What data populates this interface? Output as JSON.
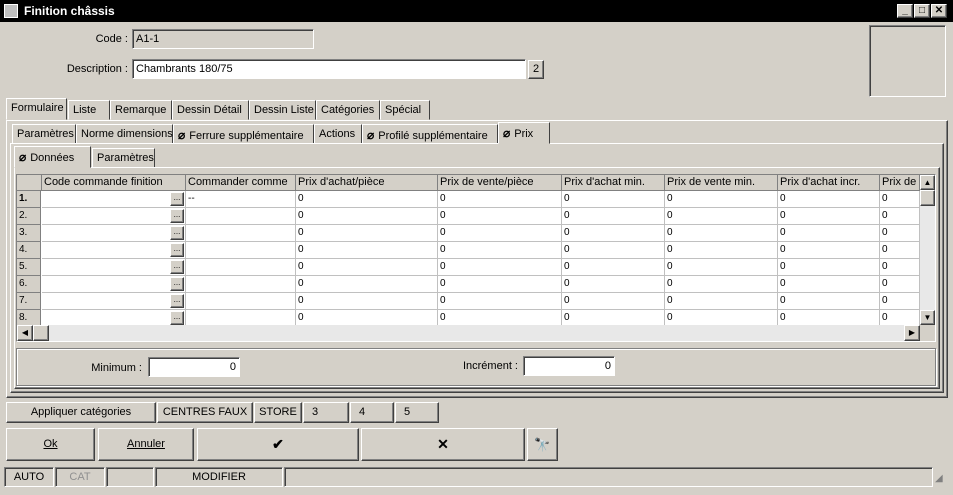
{
  "window": {
    "title": "Finition châssis",
    "minimize": "_",
    "maximize": "□",
    "close": "✕"
  },
  "header": {
    "code_label": "Code :",
    "code_value": "A1-1",
    "description_label": "Description :",
    "description_value": "Chambrants 180/75",
    "description_badge": "2"
  },
  "tabs_main": [
    "Formulaire",
    "Liste",
    "Remarque",
    "Dessin Détail",
    "Dessin Liste",
    "Catégories",
    "Spécial"
  ],
  "tabs_sub": [
    {
      "label": "Paramètres",
      "icon": ""
    },
    {
      "label": "Norme dimensions",
      "icon": ""
    },
    {
      "label": "Ferrure supplémentaire",
      "icon": "paperclip-icon"
    },
    {
      "label": "Actions",
      "icon": ""
    },
    {
      "label": "Profilé supplémentaire",
      "icon": "paperclip-icon"
    },
    {
      "label": "Prix",
      "icon": "paperclip-icon"
    }
  ],
  "tabs_inner": [
    {
      "label": "Données",
      "icon": "paperclip-icon"
    },
    {
      "label": "Paramètres",
      "icon": ""
    }
  ],
  "grid": {
    "columns": [
      "Code commande finition",
      "Commander comme",
      "Prix d'achat/pièce",
      "Prix de vente/pièce",
      "Prix d'achat min.",
      "Prix de vente min.",
      "Prix d'achat incr.",
      "Prix de vente incr."
    ],
    "rows": [
      {
        "num": "1.",
        "c0": "",
        "c1": "--",
        "c2": "0",
        "c3": "0",
        "c4": "0",
        "c5": "0",
        "c6": "0",
        "c7": "0"
      },
      {
        "num": "2.",
        "c0": "",
        "c1": "",
        "c2": "0",
        "c3": "0",
        "c4": "0",
        "c5": "0",
        "c6": "0",
        "c7": "0"
      },
      {
        "num": "3.",
        "c0": "",
        "c1": "",
        "c2": "0",
        "c3": "0",
        "c4": "0",
        "c5": "0",
        "c6": "0",
        "c7": "0"
      },
      {
        "num": "4.",
        "c0": "",
        "c1": "",
        "c2": "0",
        "c3": "0",
        "c4": "0",
        "c5": "0",
        "c6": "0",
        "c7": "0"
      },
      {
        "num": "5.",
        "c0": "",
        "c1": "",
        "c2": "0",
        "c3": "0",
        "c4": "0",
        "c5": "0",
        "c6": "0",
        "c7": "0"
      },
      {
        "num": "6.",
        "c0": "",
        "c1": "",
        "c2": "0",
        "c3": "0",
        "c4": "0",
        "c5": "0",
        "c6": "0",
        "c7": "0"
      },
      {
        "num": "7.",
        "c0": "",
        "c1": "",
        "c2": "0",
        "c3": "0",
        "c4": "0",
        "c5": "0",
        "c6": "0",
        "c7": "0"
      },
      {
        "num": "8.",
        "c0": "",
        "c1": "",
        "c2": "0",
        "c3": "0",
        "c4": "0",
        "c5": "0",
        "c6": "0",
        "c7": "0"
      }
    ],
    "ellipsis": "..."
  },
  "minmax": {
    "min_label": "Minimum :",
    "min_value": "0",
    "incr_label": "Incrément :",
    "incr_value": "0"
  },
  "category_buttons": [
    "Appliquer catégories",
    "CENTRES FAUX",
    "STORE",
    "3",
    "4",
    "5"
  ],
  "actions": {
    "ok": "Ok",
    "cancel": "Annuler",
    "confirm": "✔",
    "delete": "✕",
    "search": "🔭"
  },
  "statusbar": [
    "AUTO",
    "CAT",
    "",
    "MODIFIER",
    ""
  ]
}
